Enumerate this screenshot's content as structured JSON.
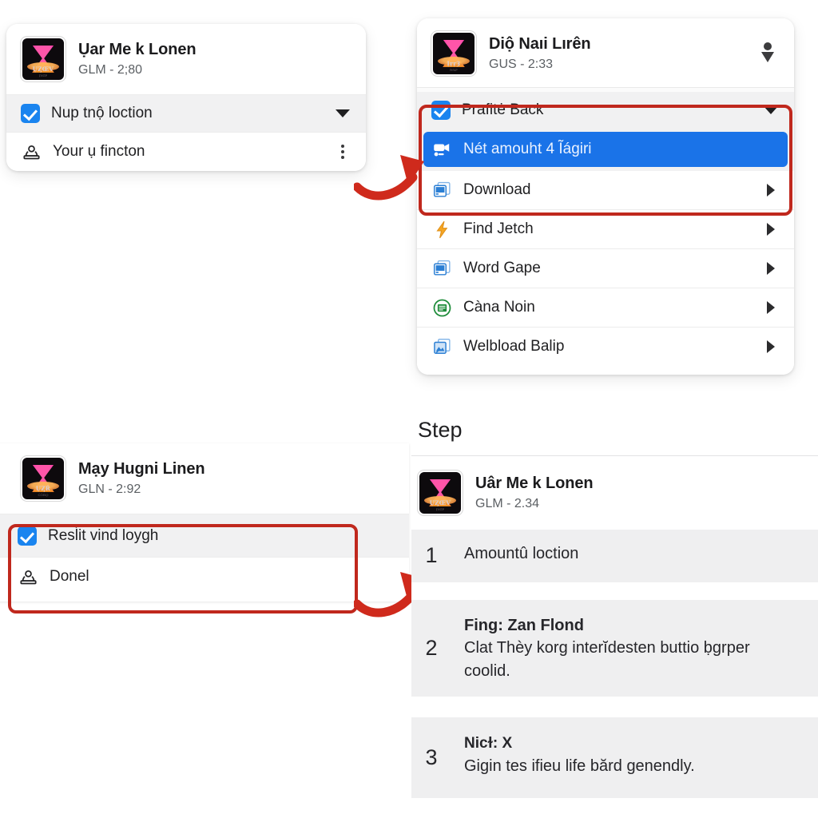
{
  "panels": {
    "top_left": {
      "app": {
        "title": "Ụar Me k Lonen",
        "subtitle": "GLM - 2;80",
        "thumb_label": "ỤȤŒV",
        "thumb_label2": "ỊVȻP"
      },
      "rows": [
        {
          "label": "Nup tnộ loction",
          "icon": "checkbox-checked-icon",
          "tail": "chevron-down-icon"
        },
        {
          "label": "Your ụ fincton",
          "icon": "stamp-person-icon",
          "tail": "kebab-menu-icon"
        }
      ]
    },
    "top_right": {
      "app": {
        "title": "Diộ Naıi Lırên",
        "subtitle": "GUS - 2:33",
        "thumb_label": "ỊŗŗȜ",
        "thumb_label2": "ŀVȽP"
      },
      "header_action": "pin-person-icon",
      "rows": [
        {
          "label": "Prafitė Back",
          "icon": "checkbox-checked-icon",
          "tail": "chevron-down-icon",
          "state": "normal"
        },
        {
          "label": "Nét amouht 4 Ĩágiri",
          "icon": "projector-icon",
          "tail": "none",
          "state": "selected"
        },
        {
          "label": "Download",
          "icon": "monitor-window-icon",
          "tail": "chevron-right-icon",
          "state": "normal"
        },
        {
          "label": "Find Jetch",
          "icon": "lightning-bolt-icon",
          "tail": "chevron-right-icon",
          "state": "normal"
        },
        {
          "label": "Word Gape",
          "icon": "monitor-window-icon",
          "tail": "chevron-right-icon",
          "state": "normal"
        },
        {
          "label": "Càna Noin",
          "icon": "green-circle-doc-icon",
          "tail": "chevron-right-icon",
          "state": "normal"
        },
        {
          "label": "Welbload Balip",
          "icon": "image-upload-icon",
          "tail": "chevron-right-icon",
          "state": "normal"
        }
      ]
    },
    "bottom_left": {
      "app": {
        "title": "Mạy Hugni Linen",
        "subtitle": "GLN - 2:92",
        "thumb_label": "ỤȤŔ",
        "thumb_label2": "ĊŎŃǪ"
      },
      "rows": [
        {
          "label": "Resĺit vind loygh",
          "icon": "checkbox-checked-icon",
          "tail": "none"
        },
        {
          "label": "Donel",
          "icon": "stamp-person-icon",
          "tail": "none"
        }
      ]
    },
    "bottom_right": {
      "heading": "Step",
      "app": {
        "title": "Uâr Me k Lonen",
        "subtitle": "GLM - 2.34",
        "thumb_label": "ỤȤŒV",
        "thumb_label2": "ỊVȻP"
      },
      "steps": [
        {
          "number": "1",
          "bold": "",
          "text": "Amountû loction"
        },
        {
          "number": "2",
          "bold": "Fing: Zan Flond",
          "text": "Clat Thèy korg interĭdesten buttio ḅgrper coolid."
        },
        {
          "number": "3",
          "bold": "Nicɫ: X",
          "text": "Gigin tes ifieu life bărd genendly."
        }
      ]
    }
  },
  "annotations": {
    "highlight_boxes": [
      {
        "name": "top-right-highlight-box"
      },
      {
        "name": "bottom-left-highlight-box"
      }
    ],
    "arrows": [
      {
        "name": "arrow-top-left-to-top-right"
      },
      {
        "name": "arrow-bottom-left-to-bottom-right"
      }
    ]
  },
  "colors": {
    "accent_blue": "#1a73e8",
    "checkbox_blue": "#1a84ef",
    "annotation_red": "#c0281d",
    "row_shade": "#f1f1f2"
  }
}
